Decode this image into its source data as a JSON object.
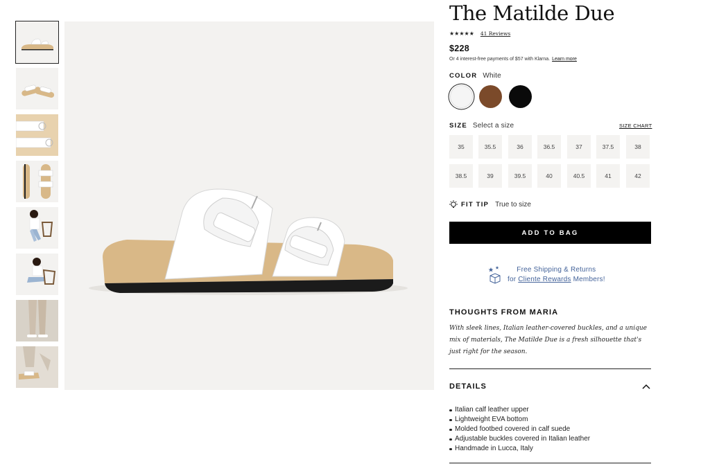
{
  "product": {
    "title": "The Matilde Due",
    "stars": "★★★★★",
    "rating": 4.5,
    "reviews_link": "41 Reviews",
    "price": "$228",
    "klarna_text": "Or 4 interest-free payments of $57 with Klarna.",
    "klarna_link": "Learn more"
  },
  "color": {
    "label": "COLOR",
    "selected": "White",
    "swatches": [
      {
        "name": "White",
        "hex": "#f5f5f5"
      },
      {
        "name": "Brown",
        "hex": "#7b4a2a"
      },
      {
        "name": "Black",
        "hex": "#0a0a0a"
      }
    ]
  },
  "size": {
    "label": "SIZE",
    "prompt": "Select a size",
    "chart_link": "SIZE CHART",
    "options": [
      "35",
      "35.5",
      "36",
      "36.5",
      "37",
      "37.5",
      "38",
      "38.5",
      "39",
      "39.5",
      "40",
      "40.5",
      "41",
      "42"
    ]
  },
  "fit_tip": {
    "label": "FIT TIP",
    "value": "True to size",
    "icon": "lightbulb-icon"
  },
  "add_to_bag": "ADD TO BAG",
  "shipping": {
    "line1": "Free Shipping & Returns",
    "line2_prefix": "for",
    "line2_link": "Cliente Rewards",
    "line2_suffix": "Members!",
    "icon": "box-stars-icon",
    "color": "#44639a"
  },
  "thoughts": {
    "title": "THOUGHTS FROM MARIA",
    "text": "With sleek lines, Italian leather-covered buckles, and a unique mix of materials, The Matilde Due is a fresh silhouette that's just right for the season."
  },
  "details": {
    "title": "DETAILS",
    "expanded": true,
    "items": [
      "Italian calf leather upper",
      "Lightweight EVA bottom",
      "Molded footbed covered in calf suede",
      "Adjustable buckles covered in Italian leather",
      "Handmade in Lucca, Italy"
    ]
  },
  "gallery": {
    "selected_index": 0,
    "thumbnails": [
      "sandal-side",
      "sandal-pair",
      "sandal-top-closeup",
      "sandal-top-pair",
      "model-seated",
      "model-seated-alt",
      "model-standing-legs",
      "model-feet-closeup"
    ]
  }
}
